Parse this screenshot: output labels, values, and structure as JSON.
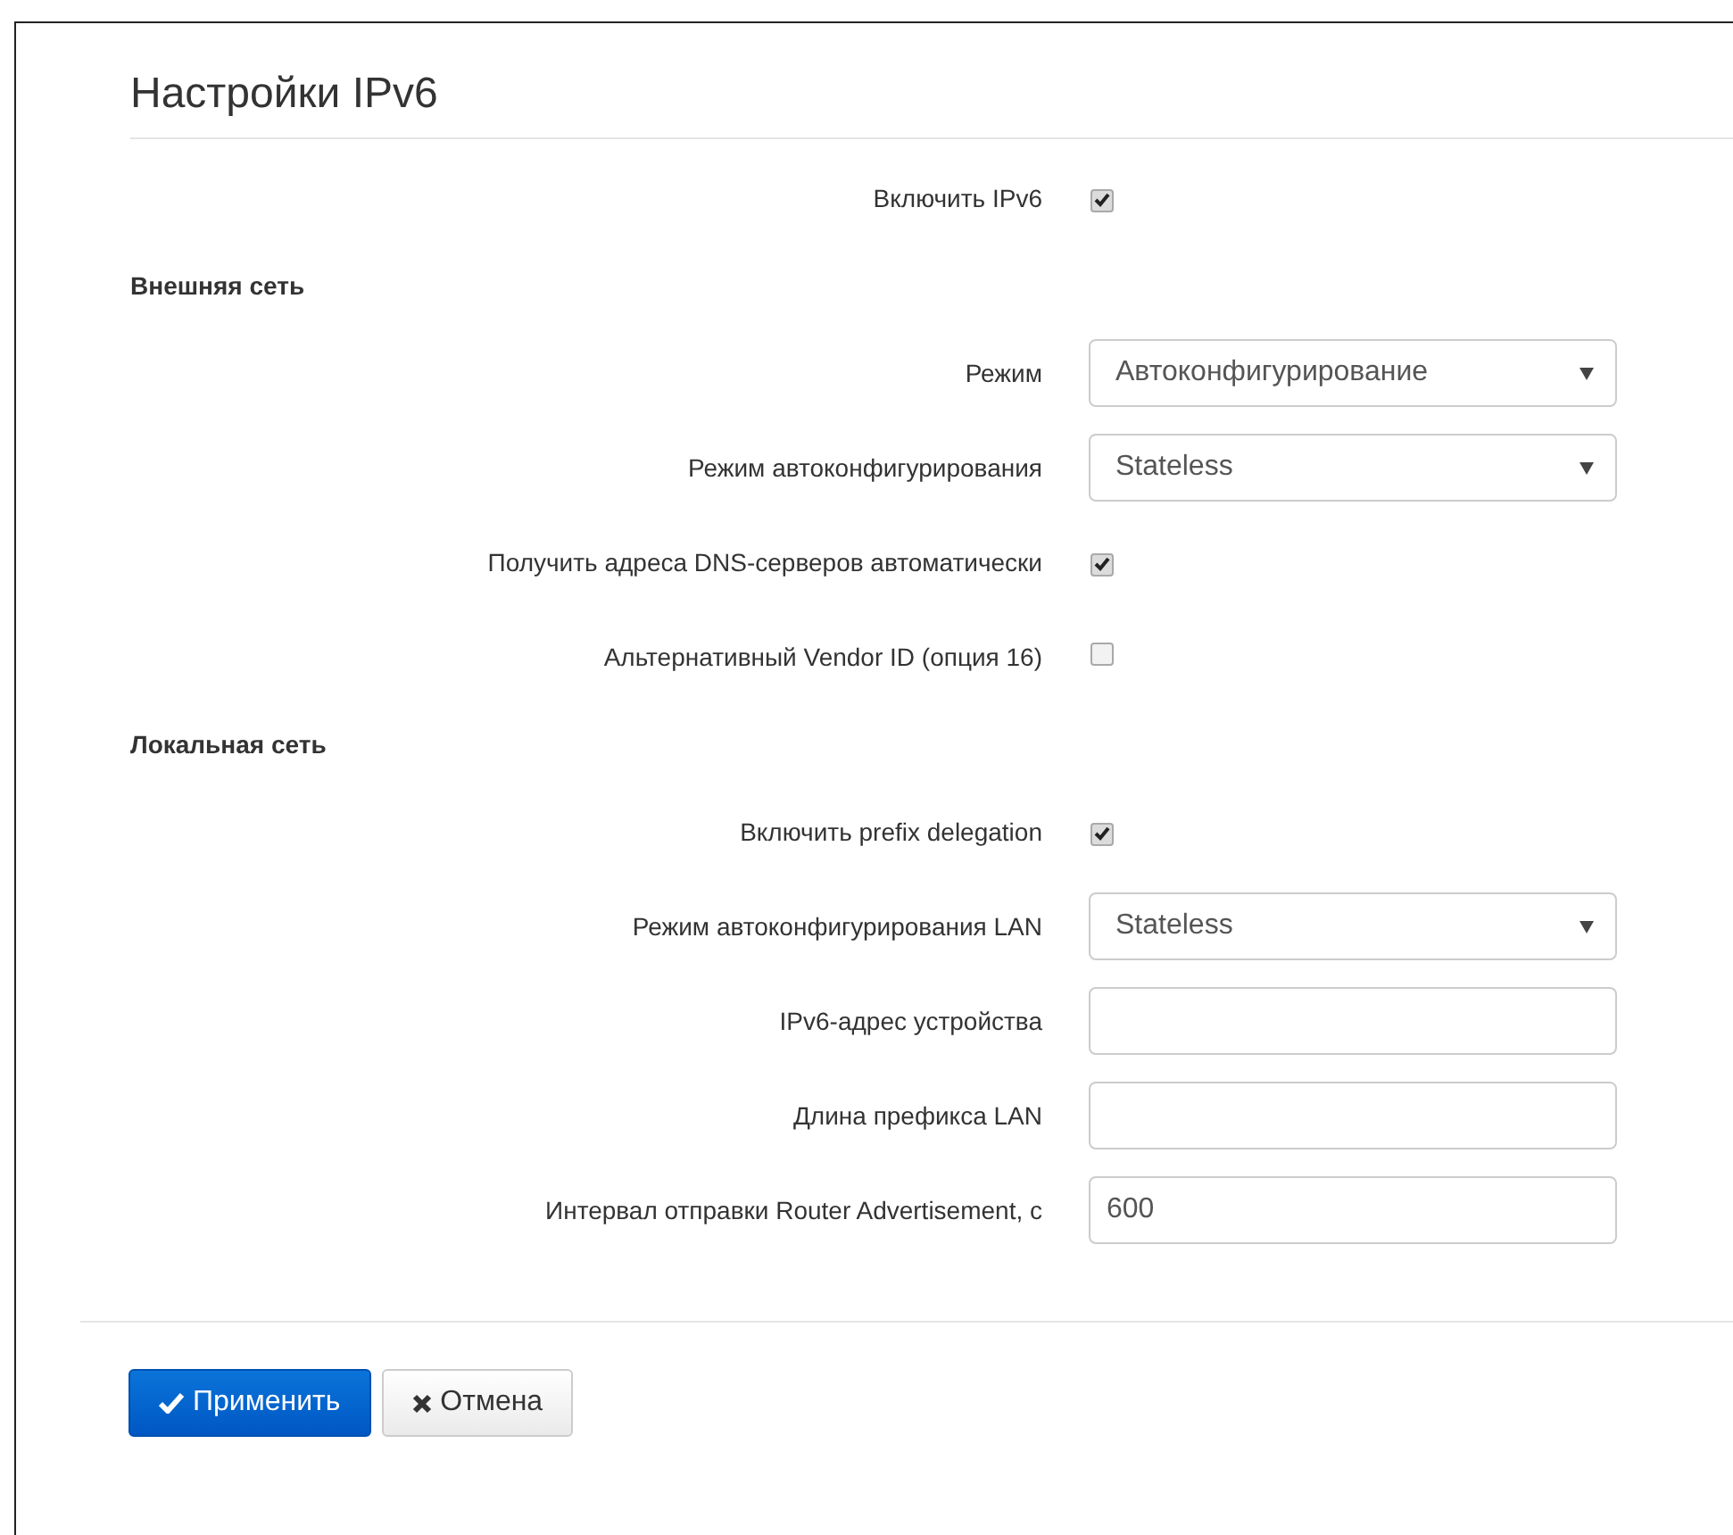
{
  "title": "Настройки IPv6",
  "sections": [
    {
      "kind": "checkbox",
      "label": "Включить IPv6",
      "checked": true
    },
    {
      "kind": "heading",
      "label": "Внешняя сеть"
    },
    {
      "kind": "select",
      "label": "Режим",
      "value": "Автоконфигурирование"
    },
    {
      "kind": "select",
      "label": "Режим автоконфигурирования",
      "value": "Stateless"
    },
    {
      "kind": "checkbox",
      "label": "Получить адреса DNS-серверов автоматически",
      "checked": true
    },
    {
      "kind": "checkbox",
      "label": "Альтернативный Vendor ID (опция 16)",
      "checked": false
    },
    {
      "kind": "heading",
      "label": "Локальная сеть"
    },
    {
      "kind": "checkbox",
      "label": "Включить prefix delegation",
      "checked": true
    },
    {
      "kind": "select",
      "label": "Режим автоконфигурирования LAN",
      "value": "Stateless"
    },
    {
      "kind": "input",
      "label": "IPv6-адрес устройства"
    },
    {
      "kind": "input",
      "label": "Длина префикса LAN"
    },
    {
      "kind": "input",
      "label": "Интервал отправки Router Advertisement, с",
      "value": "600"
    }
  ],
  "buttons": [
    {
      "kind": "primary",
      "label": "Применить"
    },
    {
      "kind": "default",
      "label": "Отмена"
    }
  ]
}
